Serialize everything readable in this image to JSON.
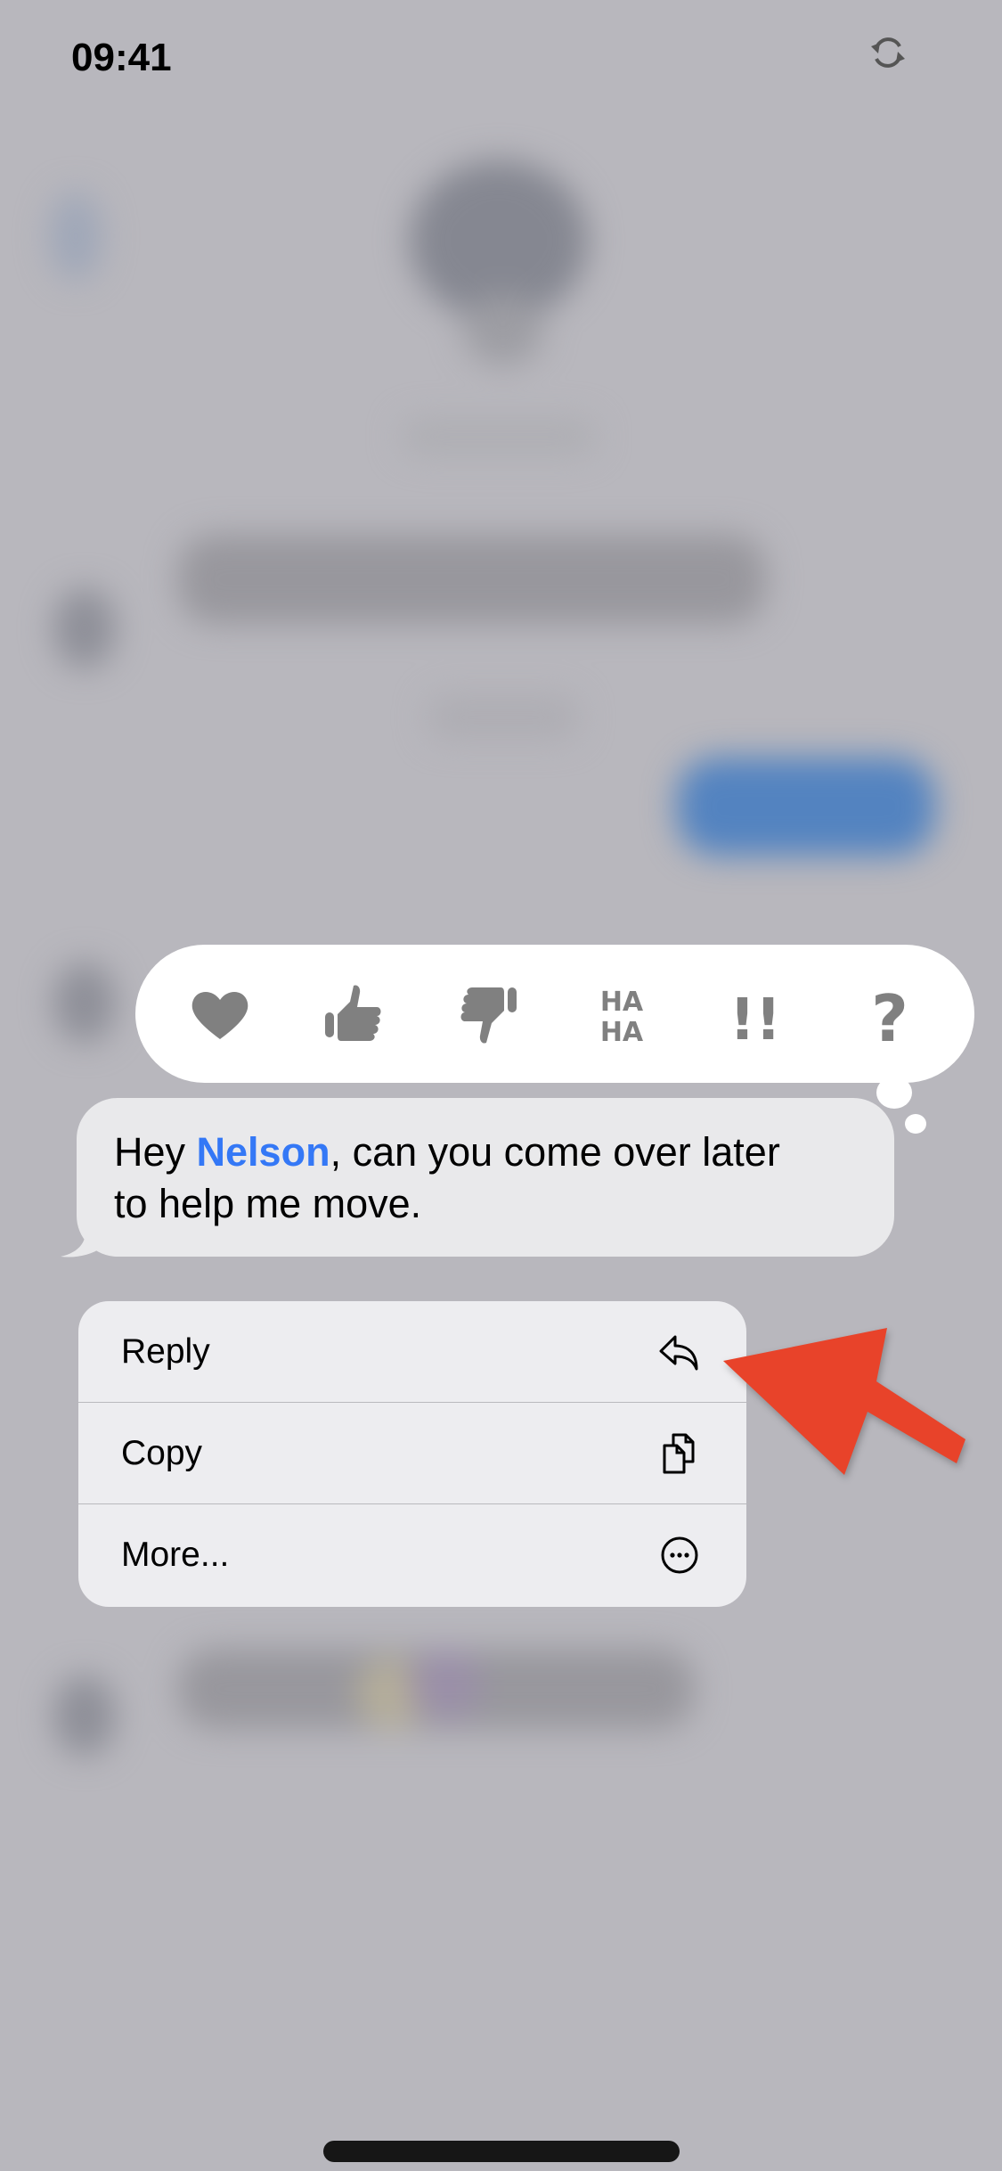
{
  "status_bar": {
    "time": "09:41",
    "right_icon": "sync-icon"
  },
  "tapbacks": [
    {
      "name": "heart",
      "icon": "heart-icon"
    },
    {
      "name": "thumbs-up",
      "icon": "thumbs-up-icon"
    },
    {
      "name": "thumbs-down",
      "icon": "thumbs-down-icon"
    },
    {
      "name": "haha",
      "icon": "haha-icon",
      "label_top": "HA",
      "label_bottom": "HA"
    },
    {
      "name": "emphasize",
      "icon": "double-exclamation-icon",
      "label": "!!"
    },
    {
      "name": "question",
      "icon": "question-icon",
      "label": "?"
    }
  ],
  "message": {
    "prefix": "Hey ",
    "mention": "Nelson",
    "suffix_line1": ", can you come over later",
    "line2": "to help me move."
  },
  "context_menu": {
    "items": [
      {
        "label": "Reply",
        "icon": "reply-icon"
      },
      {
        "label": "Copy",
        "icon": "copy-icon"
      },
      {
        "label": "More...",
        "icon": "more-icon"
      }
    ]
  },
  "colors": {
    "mention": "#3478f6",
    "annotation_arrow": "#e8432a",
    "tapback_icon": "#808080",
    "backdrop": "#b8b7bd"
  }
}
